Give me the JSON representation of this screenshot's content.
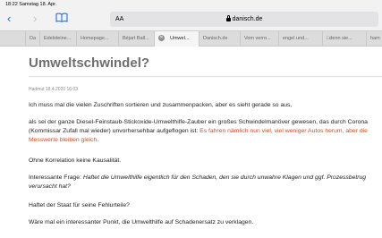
{
  "status_bar": {
    "time_date": "18:22  Samstag 18. Apr."
  },
  "browser": {
    "back_glyph": "‹",
    "forward_glyph": "›",
    "bookmarks_glyph": "📖",
    "aa_label": "AA",
    "domain": "danisch.de"
  },
  "tabs": [
    {
      "label": "Da"
    },
    {
      "label": "Edelsteine..."
    },
    {
      "label": "Homepage..."
    },
    {
      "label": "Béjart Ball..."
    },
    {
      "label": "Umwel..."
    },
    {
      "label": "Danisch.de"
    },
    {
      "label": "Vom verro..."
    },
    {
      "label": "engel und..."
    },
    {
      "label": "□denn sie..."
    },
    {
      "label": "ham"
    }
  ],
  "article": {
    "title": "Umweltschwindel?",
    "meta": "Hadmut 18.4.2020 16:03",
    "p1": "Ich muss mal die vielen Zuschriften sortieren und zusammenpacken, aber es sieht gerade so aus,",
    "p2a": "als sei der ganze Diesel-Feinstaub-Stickoxide-Umwelthilfe-Zauber ein großes Schwindelmanöver gewesen, das durch Corona (Kommissar Zufall mal wieder) unvorhersehbar aufgeflogen ist: ",
    "p2b": "Es fahren nämlich nun viel, viel weniger Autos herum, aber die Messwerte bleiben gleich.",
    "p3": "Ohne Korrelation keine Kausalität.",
    "p4a": "Interessante Frage: ",
    "p4b": "Haftet die Umwelthilfe eigentlich für den Schaden, den sie durch unwahre Klagen und ggf. Prozessbetrug verursacht hat?",
    "p5": "Haftet der Staat für seine Fehlurteile?",
    "p6": "Wäre mal ein interessanter Punkt, die Umwelthilfe auf Schadenersatz zu verklagen."
  },
  "colors": {
    "accent": "#1a73e8",
    "highlight": "#d54b1e"
  }
}
